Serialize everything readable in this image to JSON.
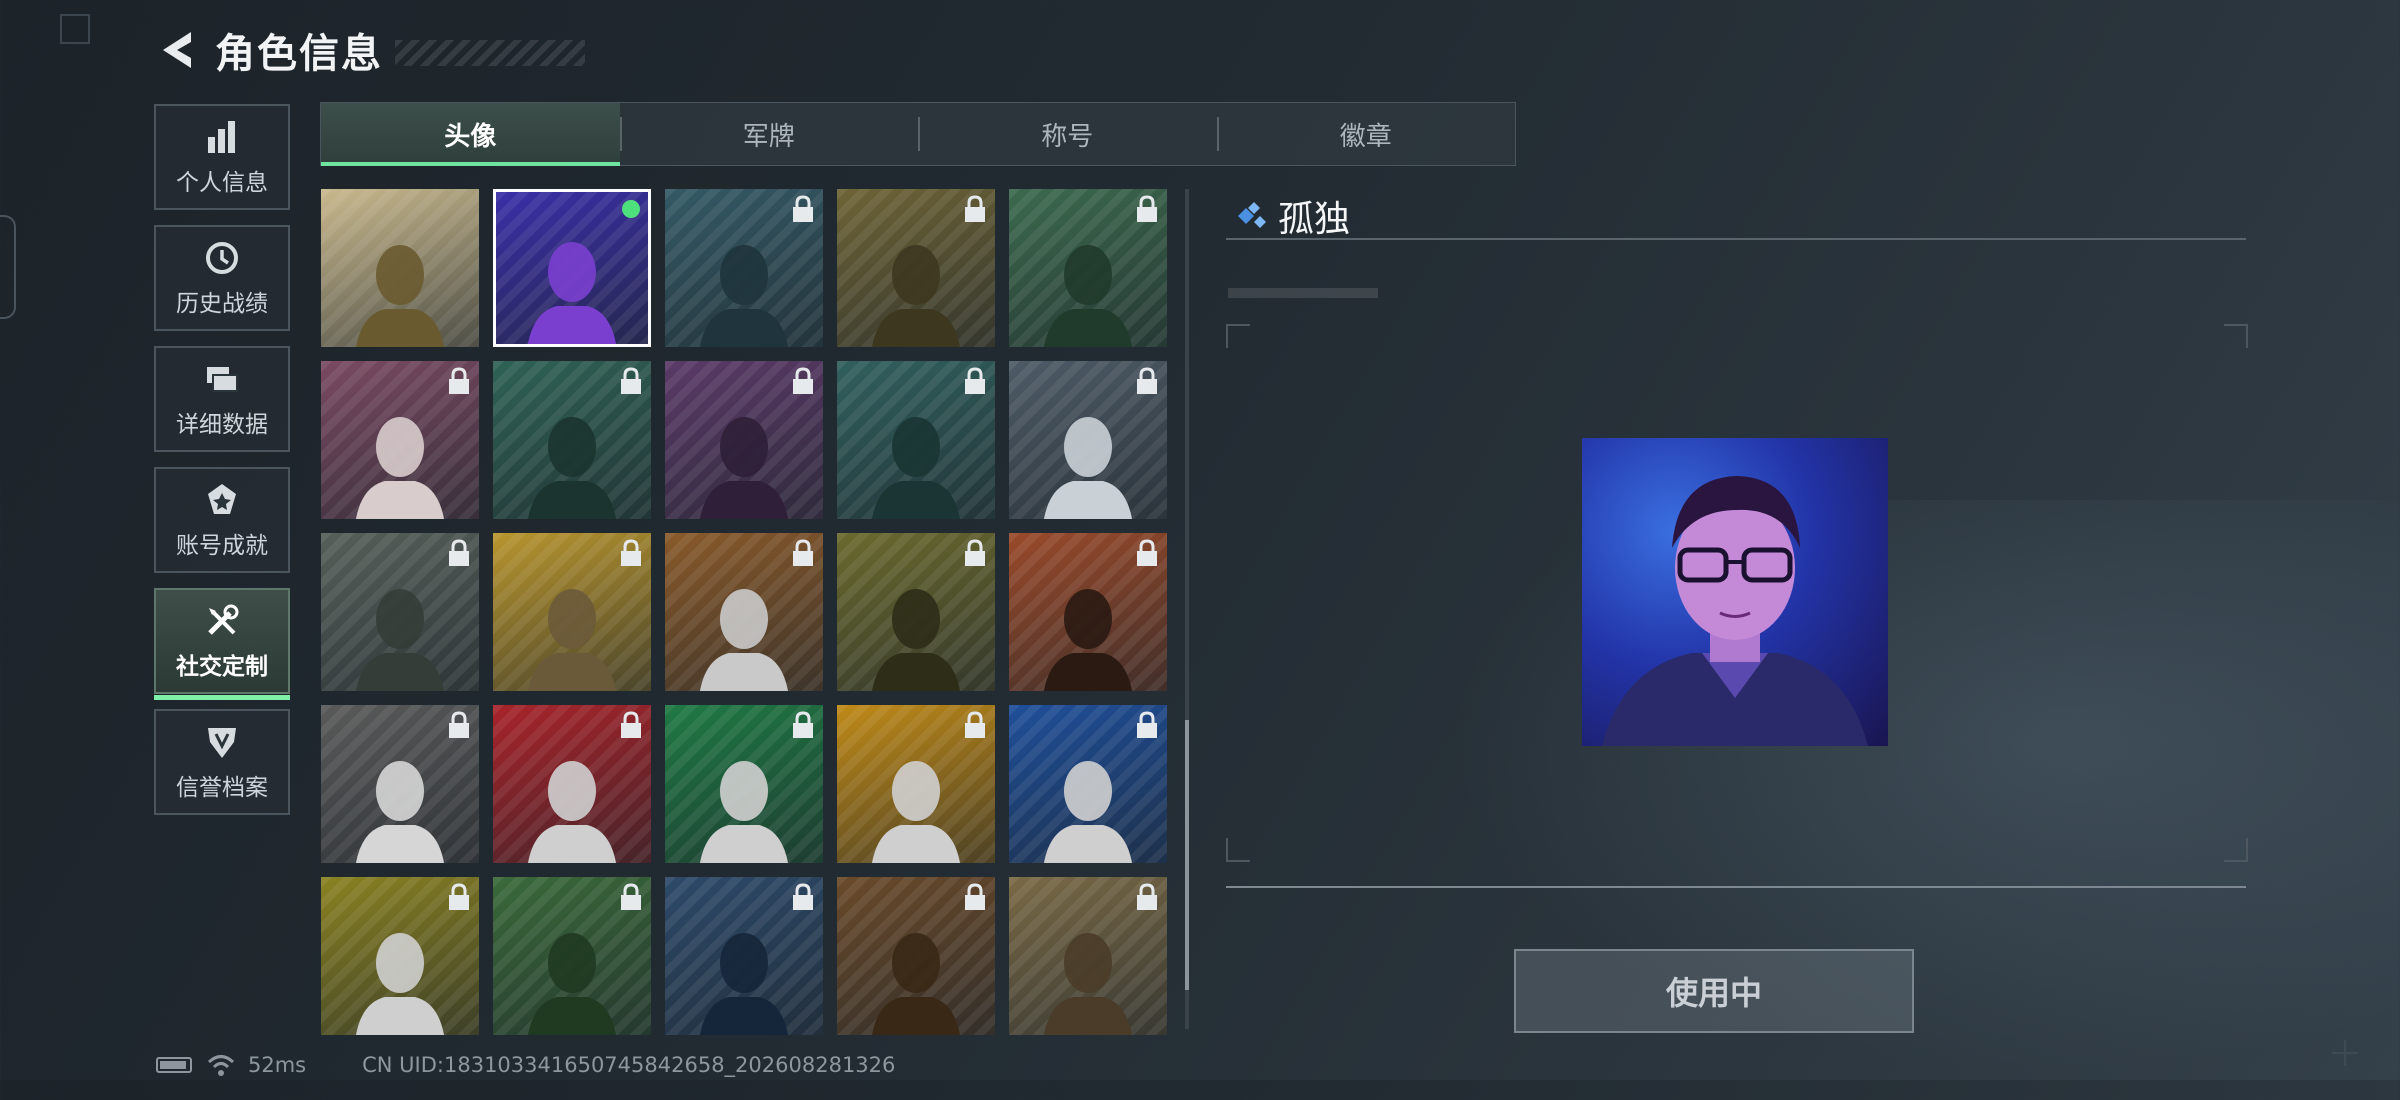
{
  "header": {
    "title": "角色信息"
  },
  "nav": [
    {
      "label": "个人信息",
      "icon": "bar-chart-icon",
      "active": false
    },
    {
      "label": "历史战绩",
      "icon": "history-icon",
      "active": false
    },
    {
      "label": "详细数据",
      "icon": "folder-icon",
      "active": false
    },
    {
      "label": "账号成就",
      "icon": "achievement-icon",
      "active": false
    },
    {
      "label": "社交定制",
      "icon": "tools-icon",
      "active": true
    },
    {
      "label": "信誉档案",
      "icon": "shield-icon",
      "active": false
    }
  ],
  "tabs": [
    {
      "label": "头像",
      "active": true
    },
    {
      "label": "军牌",
      "active": false
    },
    {
      "label": "称号",
      "active": false
    },
    {
      "label": "徽章",
      "active": false
    }
  ],
  "avatars": [
    {
      "bg": "#c9b98d",
      "fig": "#6a5a30",
      "locked": false,
      "selected": false,
      "name": "dinosaur-avatar"
    },
    {
      "bg": "#3b2fa8",
      "fig": "#7a3fcf",
      "locked": false,
      "selected": true,
      "name": "glasses-man-avatar"
    },
    {
      "bg": "#345a66",
      "fig": "#1f343c",
      "locked": true,
      "selected": false,
      "name": "pilot-avatar"
    },
    {
      "bg": "#6e6436",
      "fig": "#3e3720",
      "locked": true,
      "selected": false,
      "name": "bald-operator-avatar"
    },
    {
      "bg": "#3c6a4e",
      "fig": "#203a2b",
      "locked": true,
      "selected": false,
      "name": "headset-man-avatar"
    },
    {
      "bg": "#7a4a62",
      "fig": "#d8cccc",
      "locked": true,
      "selected": false,
      "name": "white-hair-avatar"
    },
    {
      "bg": "#2f6256",
      "fig": "#1b3430",
      "locked": true,
      "selected": false,
      "name": "bearded-man-avatar"
    },
    {
      "bg": "#5b3a68",
      "fig": "#2f1f38",
      "locked": true,
      "selected": false,
      "name": "girl-avatar"
    },
    {
      "bg": "#31605e",
      "fig": "#1a3533",
      "locked": true,
      "selected": false,
      "name": "masked-soldier-avatar"
    },
    {
      "bg": "#4e5b66",
      "fig": "#c9d0d6",
      "locked": true,
      "selected": false,
      "name": "star-emblem-avatar"
    },
    {
      "bg": "#56605a",
      "fig": "#353d38",
      "locked": true,
      "selected": false,
      "name": "helicopter-scene-avatar"
    },
    {
      "bg": "#b8952e",
      "fig": "#6b5a3a",
      "locked": true,
      "selected": false,
      "name": "cartoon-hand-avatar"
    },
    {
      "bg": "#8a5a2a",
      "fig": "#c9c9c9",
      "locked": true,
      "selected": false,
      "name": "eri-logo-avatar"
    },
    {
      "bg": "#6b6a2e",
      "fig": "#2e2d18",
      "locked": true,
      "selected": false,
      "name": "glasses-soldier-avatar"
    },
    {
      "bg": "#9a4a2a",
      "fig": "#2a1a12",
      "locked": true,
      "selected": false,
      "name": "explosion-avatar"
    },
    {
      "bg": "#5a5a5a",
      "fig": "#d6d6d6",
      "locked": true,
      "selected": false,
      "name": "gunner-sketch-avatar"
    },
    {
      "bg": "#a8242a",
      "fig": "#cfcfcf",
      "locked": true,
      "selected": false,
      "name": "shield-logo-avatar"
    },
    {
      "bg": "#1f7a44",
      "fig": "#cfcfcf",
      "locked": true,
      "selected": false,
      "name": "medic-cross-avatar"
    },
    {
      "bg": "#c08a18",
      "fig": "#cfcfcf",
      "locked": true,
      "selected": false,
      "name": "a-logo-avatar"
    },
    {
      "bg": "#1f4f9a",
      "fig": "#cfcfcf",
      "locked": true,
      "selected": false,
      "name": "hex-logo-avatar"
    },
    {
      "bg": "#8a8222",
      "fig": "#cfcfcf",
      "locked": true,
      "selected": false,
      "name": "diamond-logo-avatar"
    },
    {
      "bg": "#3a6a3a",
      "fig": "#1f3a20",
      "locked": true,
      "selected": false,
      "name": "female-soldier-avatar"
    },
    {
      "bg": "#2d4a6a",
      "fig": "#16263a",
      "locked": true,
      "selected": false,
      "name": "long-hair-man-avatar"
    },
    {
      "bg": "#6a4a2a",
      "fig": "#3a2816",
      "locked": true,
      "selected": false,
      "name": "rugged-man-avatar"
    },
    {
      "bg": "#7a6a46",
      "fig": "#4a3c28",
      "locked": true,
      "selected": false,
      "name": "launcher-soldier-avatar"
    }
  ],
  "detail": {
    "name": "孤独",
    "button_label": "使用中"
  },
  "status": {
    "ping": "52ms",
    "uid": "CN UID:18310334165074584265​8_202608281326"
  }
}
